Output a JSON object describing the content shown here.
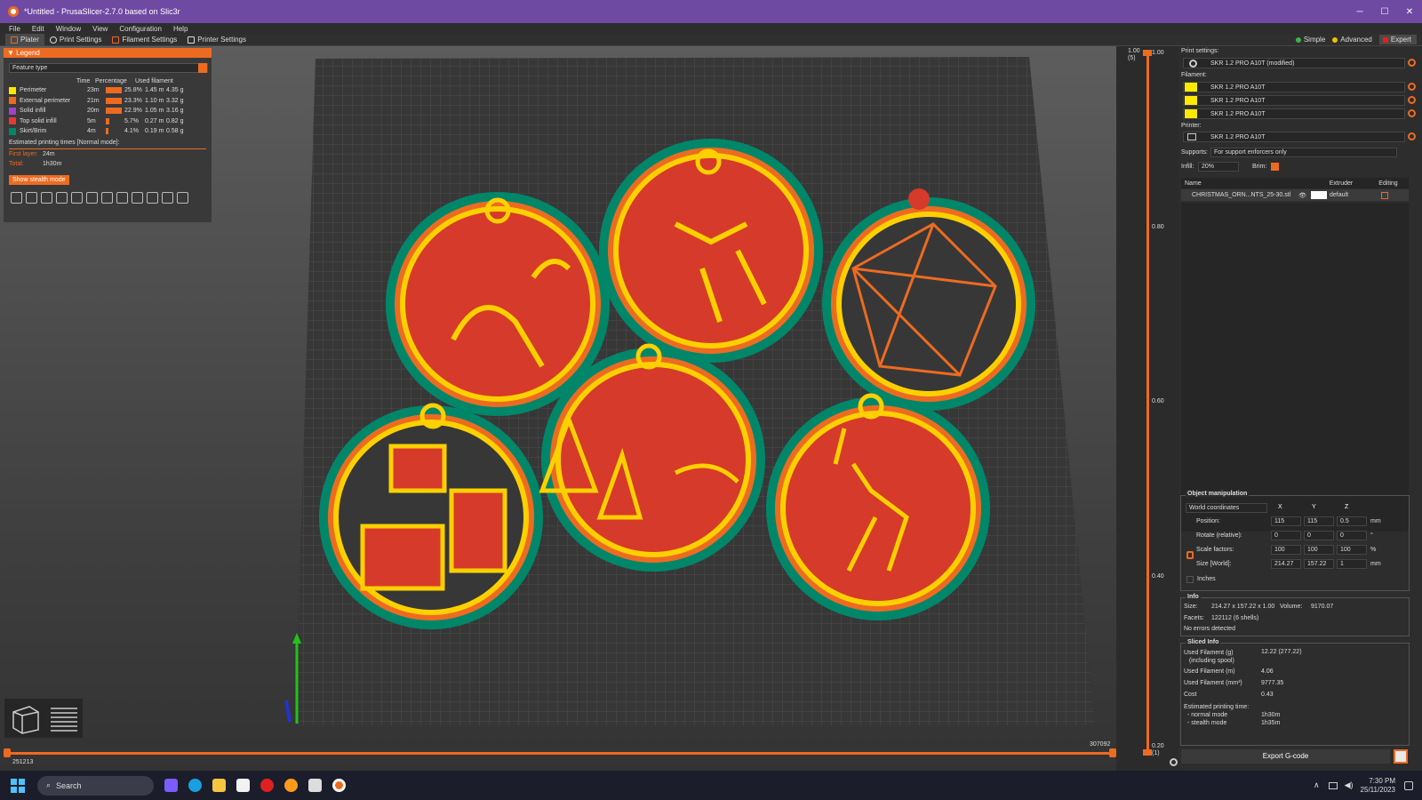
{
  "window": {
    "title": "*Untitled - PrusaSlicer-2.7.0 based on Slic3r"
  },
  "menu": [
    "File",
    "Edit",
    "Window",
    "View",
    "Configuration",
    "Help"
  ],
  "tabs": [
    "Plater",
    "Print Settings",
    "Filament Settings",
    "Printer Settings"
  ],
  "modes": [
    {
      "label": "Simple",
      "color": "#3bb54a"
    },
    {
      "label": "Advanced",
      "color": "#f0c000"
    },
    {
      "label": "Expert",
      "color": "#e52020"
    }
  ],
  "legend": {
    "header": "Legend",
    "view_type": "Feature type",
    "columns": [
      "Time",
      "Percentage",
      "Used filament"
    ],
    "rows": [
      {
        "name": "Perimeter",
        "color": "#ffe600",
        "time": "23m",
        "pct": "25.8%",
        "len": "1.45 m",
        "weight": "4.35 g",
        "frac": 0.258
      },
      {
        "name": "External perimeter",
        "color": "#ed6b21",
        "time": "21m",
        "pct": "23.3%",
        "len": "1.10 m",
        "weight": "3.32 g",
        "frac": 0.233
      },
      {
        "name": "Solid infill",
        "color": "#9c44cb",
        "time": "20m",
        "pct": "22.9%",
        "len": "1.05 m",
        "weight": "3.16 g",
        "frac": 0.229
      },
      {
        "name": "Top solid infill",
        "color": "#e53935",
        "time": "5m",
        "pct": "5.7%",
        "len": "0.27 m",
        "weight": "0.82 g",
        "frac": 0.057
      },
      {
        "name": "Skirt/Brim",
        "color": "#00876a",
        "time": "4m",
        "pct": "4.1%",
        "len": "0.19 m",
        "weight": "0.58 g",
        "frac": 0.041
      }
    ],
    "est_title": "Estimated printing times [Normal mode]:",
    "first_layer_label": "First layer:",
    "first_layer": "24m",
    "total_label": "Total:",
    "total": "1h30m",
    "stealth_btn": "Show stealth mode"
  },
  "sliders": {
    "h_left": "251213",
    "h_right": "307092",
    "v_top": "1.00",
    "v_top_sub": "(5)",
    "v_bottom": "0.20",
    "v_bottom_sub": "(1)",
    "ticks": [
      "1.00",
      "0.80",
      "0.60",
      "0.40",
      "0.20"
    ]
  },
  "right": {
    "print_settings_label": "Print settings:",
    "print_profile": "SKR 1.2 PRO A10T (modified)",
    "filament_label": "Filament:",
    "filaments": [
      "SKR 1.2 PRO A10T",
      "SKR 1.2 PRO A10T",
      "SKR 1.2 PRO A10T"
    ],
    "printer_label": "Printer:",
    "printer": "SKR 1.2 PRO A10T",
    "supports_label": "Supports:",
    "supports": "For support enforcers only",
    "infill_label": "Infill:",
    "infill": "20%",
    "brim_label": "Brim:",
    "list_cols": [
      "Name",
      "Extruder",
      "Editing"
    ],
    "object_name": "CHRISTMAS_ORN...NTS_25-30.stl",
    "object_extruder": "default"
  },
  "manip": {
    "title": "Object manipulation",
    "coords": "World coordinates",
    "axes": [
      "X",
      "Y",
      "Z"
    ],
    "position_label": "Position:",
    "position": [
      "115",
      "115",
      "0.5"
    ],
    "position_unit": "mm",
    "rotate_label": "Rotate (relative):",
    "rotate": [
      "0",
      "0",
      "0"
    ],
    "rotate_unit": "°",
    "scale_label": "Scale factors:",
    "scale": [
      "100",
      "100",
      "100"
    ],
    "scale_unit": "%",
    "size_label": "Size [World]:",
    "size": [
      "214.27",
      "157.22",
      "1"
    ],
    "size_unit": "mm",
    "inches_label": "Inches"
  },
  "info": {
    "title": "Info",
    "size_label": "Size:",
    "size": "214.27 x 157.22 x 1.00",
    "volume_label": "Volume:",
    "volume": "9170.07",
    "facets_label": "Facets:",
    "facets": "122112 (6 shells)",
    "errors": "No errors detected"
  },
  "sliced": {
    "title": "Sliced Info",
    "rows": [
      {
        "label": "Used Filament (g)",
        "sub": "(including spool)",
        "value": "12.22 (277.22)"
      },
      {
        "label": "Used Filament (m)",
        "value": "4.06"
      },
      {
        "label": "Used Filament (mm³)",
        "value": "9777.35"
      },
      {
        "label": "Cost",
        "value": "0.43"
      }
    ],
    "time_label": "Estimated printing time:",
    "normal_label": "- normal mode",
    "normal": "1h30m",
    "stealth_label": "- stealth mode",
    "stealth": "1h35m"
  },
  "export_label": "Export G-code",
  "taskbar": {
    "search": "Search",
    "time": "7:30 PM",
    "date": "25/11/2023"
  }
}
